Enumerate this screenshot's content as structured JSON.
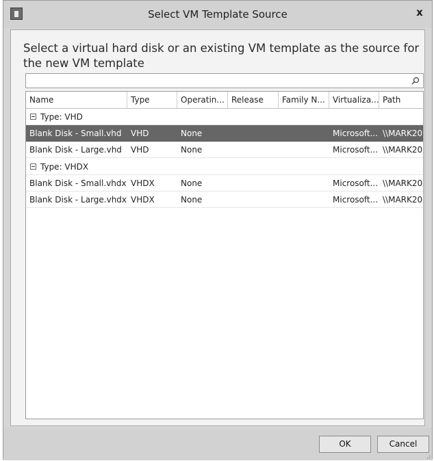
{
  "window": {
    "title": "Select VM Template Source",
    "close_label": "x"
  },
  "instruction": "Select a virtual hard disk or an existing VM template as the source for the new VM template",
  "search": {
    "value": "",
    "placeholder": ""
  },
  "grid": {
    "columns": [
      "Name",
      "Type",
      "Operatin...",
      "Release",
      "Family N...",
      "Virtualiza...",
      "Path"
    ],
    "groups": [
      {
        "label": "Type:  VHD",
        "rows": [
          {
            "name": "Blank Disk - Small.vhd",
            "type": "VHD",
            "os": "None",
            "release": "",
            "family": "",
            "virtualization": "Microsoft...",
            "path": "\\\\MARK20...",
            "selected": true
          },
          {
            "name": "Blank Disk - Large.vhd",
            "type": "VHD",
            "os": "None",
            "release": "",
            "family": "",
            "virtualization": "Microsoft...",
            "path": "\\\\MARK20...",
            "selected": false
          }
        ]
      },
      {
        "label": "Type:  VHDX",
        "rows": [
          {
            "name": "Blank Disk - Small.vhdx",
            "type": "VHDX",
            "os": "None",
            "release": "",
            "family": "",
            "virtualization": "Microsoft...",
            "path": "\\\\MARK20...",
            "selected": false
          },
          {
            "name": "Blank Disk - Large.vhdx",
            "type": "VHDX",
            "os": "None",
            "release": "",
            "family": "",
            "virtualization": "Microsoft...",
            "path": "\\\\MARK20...",
            "selected": false
          }
        ]
      }
    ]
  },
  "buttons": {
    "ok": "OK",
    "cancel": "Cancel"
  },
  "colors": {
    "selection": "#666666",
    "chrome": "#d2d2d2"
  }
}
